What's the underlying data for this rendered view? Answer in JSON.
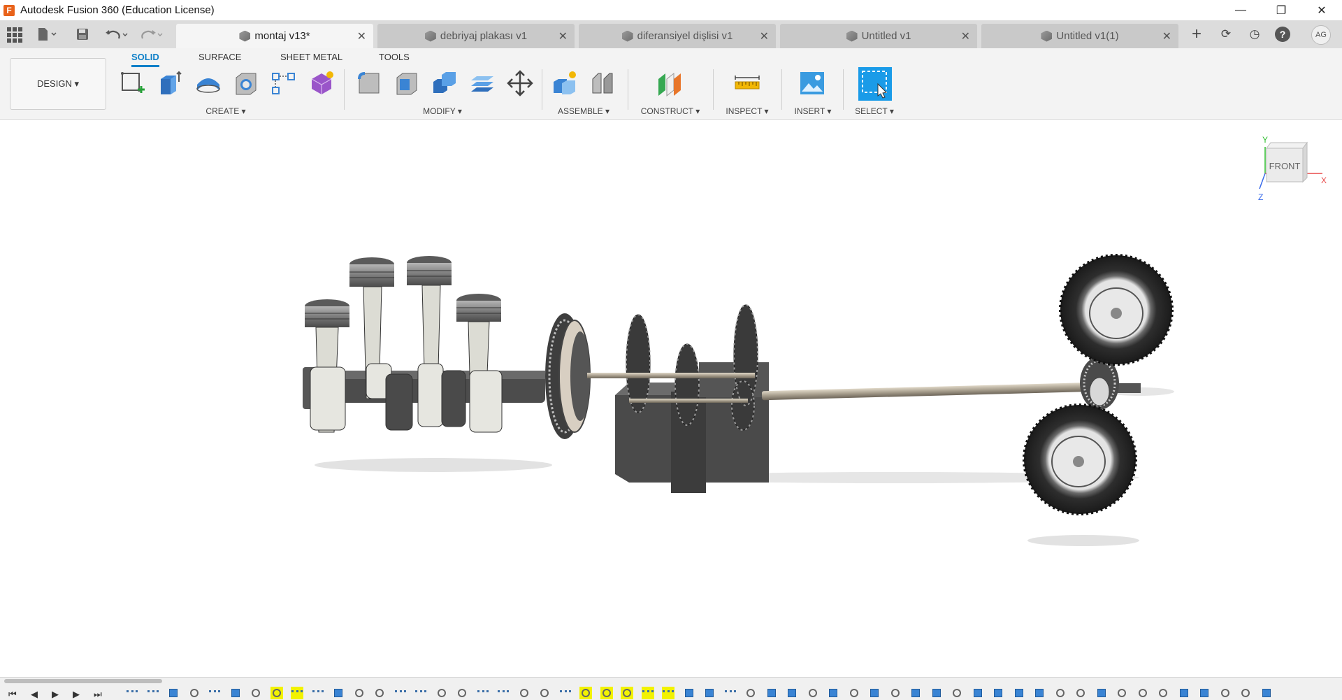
{
  "window": {
    "title": "Autodesk Fusion 360 (Education License)",
    "logo_letter": "F",
    "minimize": "—",
    "maximize": "❐",
    "close": "✕"
  },
  "tabs": [
    {
      "label": "montaj v13*",
      "active": true
    },
    {
      "label": "debriyaj plakası v1",
      "active": false
    },
    {
      "label": "diferansiyel dişlisi v1",
      "active": false
    },
    {
      "label": "Untitled v1",
      "active": false
    },
    {
      "label": "Untitled v1(1)",
      "active": false
    }
  ],
  "tab_close": "✕",
  "toolbar_icons": {
    "add_tab": "+",
    "extensions": "⟳",
    "job_status": "◷",
    "help": "?",
    "avatar": "AG"
  },
  "ribbon": {
    "workspace": "DESIGN ▾",
    "tabs": [
      "SOLID",
      "SURFACE",
      "SHEET METAL",
      "TOOLS"
    ],
    "groups": {
      "create": "CREATE ▾",
      "modify": "MODIFY ▾",
      "assemble": "ASSEMBLE ▾",
      "construct": "CONSTRUCT ▾",
      "inspect": "INSPECT ▾",
      "insert": "INSERT ▾",
      "select": "SELECT ▾"
    }
  },
  "viewcube": {
    "face": "FRONT",
    "axis_x": "X",
    "axis_y": "Y",
    "axis_z": "Z"
  },
  "timeline": {
    "controls": [
      "⏮",
      "◀",
      "▶",
      "▶",
      "⏭"
    ]
  },
  "colors": {
    "accent": "#0d7fc8",
    "timeline_highlight": "#f2f200"
  }
}
